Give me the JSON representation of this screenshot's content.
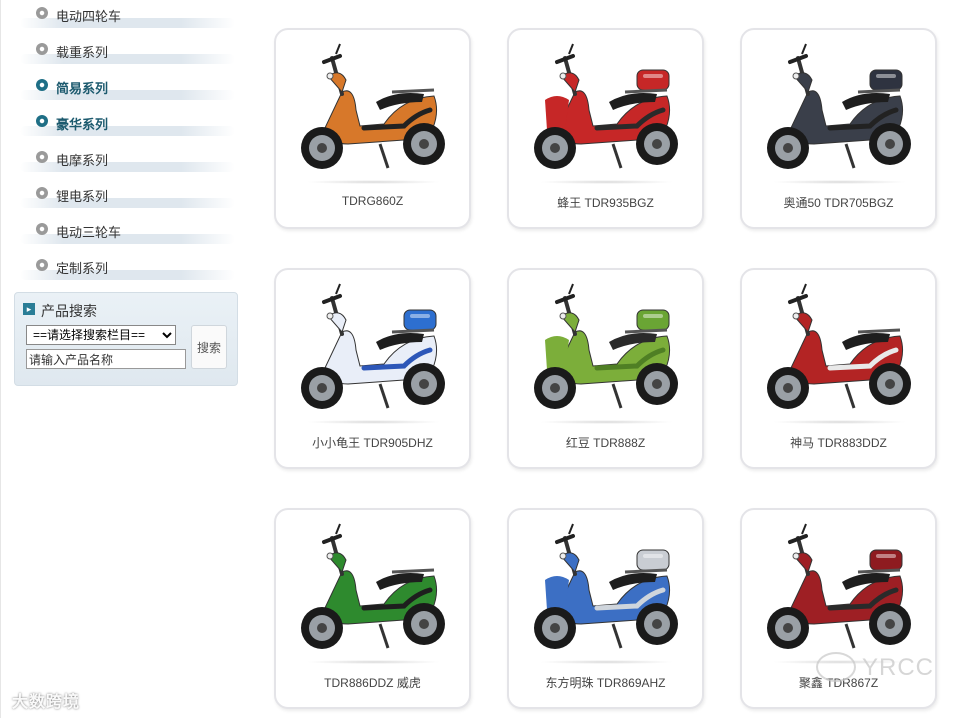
{
  "sidebar": {
    "categories": [
      {
        "label": "电动四轮车",
        "active": false
      },
      {
        "label": "载重系列",
        "active": false
      },
      {
        "label": "简易系列",
        "active": true
      },
      {
        "label": "豪华系列",
        "active": true
      },
      {
        "label": "电摩系列",
        "active": false
      },
      {
        "label": "锂电系列",
        "active": false
      },
      {
        "label": "电动三轮车",
        "active": false
      },
      {
        "label": "定制系列",
        "active": false
      }
    ],
    "search": {
      "title": "产品搜索",
      "select_value": "==请选择搜索栏目==",
      "input_value": "请输入产品名称",
      "button_label": "搜索"
    }
  },
  "products": [
    {
      "caption": "TDRG860Z",
      "colors": {
        "body": "#d7782a",
        "accent": "#222222",
        "seat": "#1e1e1e",
        "box": ""
      }
    },
    {
      "caption": "蜂王 TDR935BGZ",
      "colors": {
        "body": "#c62727",
        "accent": "#2a2a2a",
        "seat": "#1e1e1e",
        "box": "#c62727"
      }
    },
    {
      "caption": "奥通50 TDR705BGZ",
      "colors": {
        "body": "#3a3f4a",
        "accent": "#222222",
        "seat": "#1e1e1e",
        "box": "#2e3340"
      }
    },
    {
      "caption": "小小龟王 TDR905DHZ",
      "colors": {
        "body": "#e9eef8",
        "accent": "#2d57b8",
        "seat": "#1e1e1e",
        "box": "#2d6fd0"
      }
    },
    {
      "caption": "红豆 TDR888Z",
      "colors": {
        "body": "#7cae3a",
        "accent": "#4f7f24",
        "seat": "#2a2a2a",
        "box": "#6aa534"
      }
    },
    {
      "caption": "神马 TDR883DDZ",
      "colors": {
        "body": "#b32424",
        "accent": "#e9e9e9",
        "seat": "#1e1e1e",
        "box": ""
      }
    },
    {
      "caption": "TDR886DDZ 威虎",
      "colors": {
        "body": "#2e8a2e",
        "accent": "#1e1e1e",
        "seat": "#1e1e1e",
        "box": ""
      }
    },
    {
      "caption": "东方明珠 TDR869AHZ",
      "colors": {
        "body": "#3c6fc4",
        "accent": "#cfd5dc",
        "seat": "#1e1e1e",
        "box": "#c9cdd3"
      }
    },
    {
      "caption": "聚鑫 TDR867Z",
      "colors": {
        "body": "#9e1f24",
        "accent": "#2a2a2a",
        "seat": "#1e1e1e",
        "box": "#8e1b20"
      }
    }
  ],
  "watermark_left": "大数跨境",
  "watermark_right": "YRCC"
}
